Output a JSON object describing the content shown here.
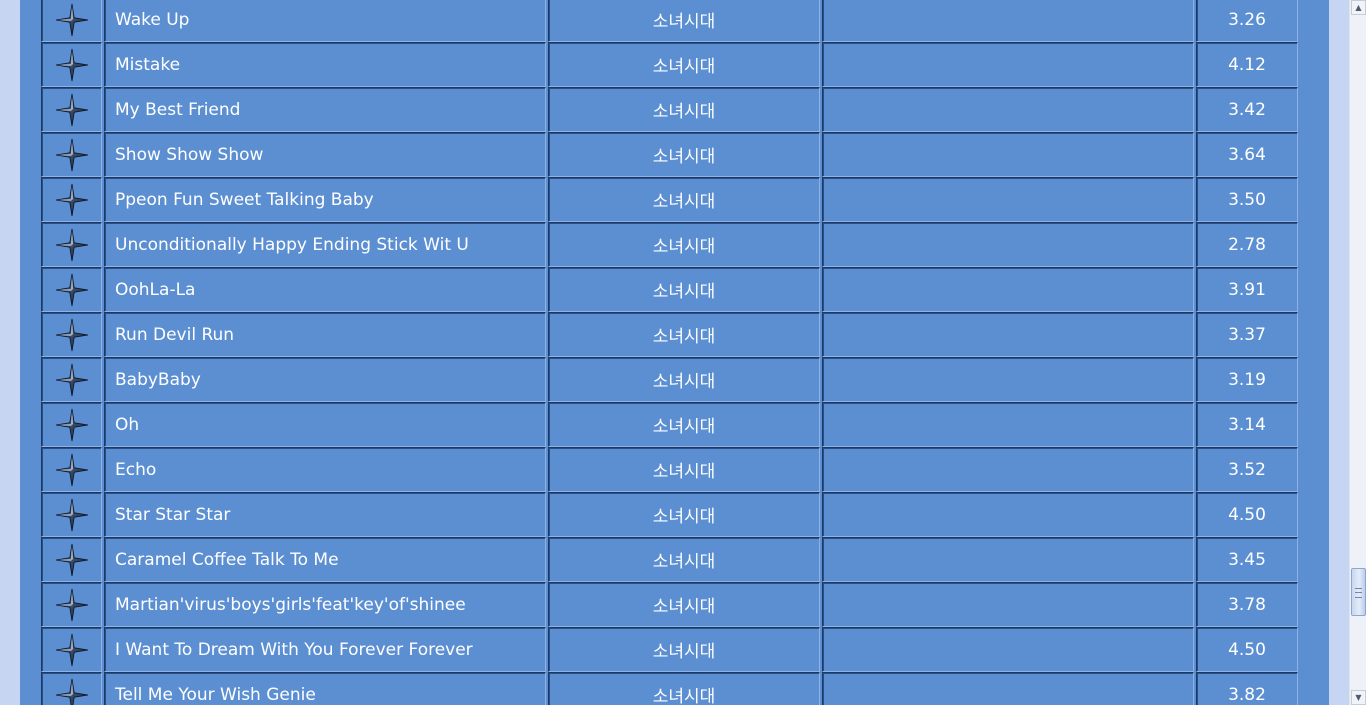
{
  "songs": [
    {
      "title": "Wake Up",
      "artist": "소녀시대",
      "score": "3.26"
    },
    {
      "title": "Mistake",
      "artist": "소녀시대",
      "score": "4.12"
    },
    {
      "title": "My Best Friend",
      "artist": "소녀시대",
      "score": "3.42"
    },
    {
      "title": "Show Show Show",
      "artist": "소녀시대",
      "score": "3.64"
    },
    {
      "title": "Ppeon Fun Sweet Talking Baby",
      "artist": "소녀시대",
      "score": "3.50"
    },
    {
      "title": "Unconditionally Happy Ending Stick Wit U",
      "artist": "소녀시대",
      "score": "2.78"
    },
    {
      "title": "OohLa-La",
      "artist": "소녀시대",
      "score": "3.91"
    },
    {
      "title": "Run Devil Run",
      "artist": "소녀시대",
      "score": "3.37"
    },
    {
      "title": "BabyBaby",
      "artist": "소녀시대",
      "score": "3.19"
    },
    {
      "title": "Oh",
      "artist": "소녀시대",
      "score": "3.14"
    },
    {
      "title": "Echo",
      "artist": "소녀시대",
      "score": "3.52"
    },
    {
      "title": "Star Star Star",
      "artist": "소녀시대",
      "score": "4.50"
    },
    {
      "title": "Caramel Coffee Talk To Me",
      "artist": "소녀시대",
      "score": "3.45"
    },
    {
      "title": "Martian'virus'boys'girls'feat'key'of'shinee",
      "artist": "소녀시대",
      "score": "3.78"
    },
    {
      "title": "I Want To Dream With You Forever Forever",
      "artist": "소녀시대",
      "score": "4.50"
    },
    {
      "title": "Tell Me Your Wish Genie",
      "artist": "소녀시대",
      "score": "3.82"
    }
  ],
  "icons": {
    "add": "plus-cross-icon",
    "scroll_up": "arrow-up-icon",
    "scroll_down": "arrow-down-icon"
  },
  "colors": {
    "page_background": "#c5d5f2",
    "table_background": "#5b8fd2",
    "text": "#ffffff"
  }
}
